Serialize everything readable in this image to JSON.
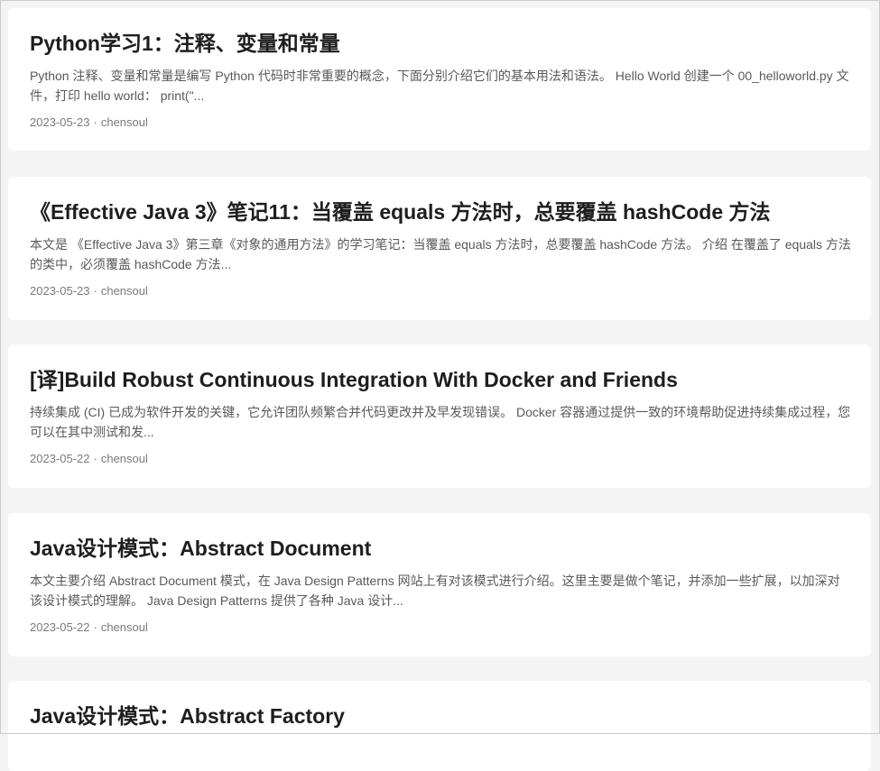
{
  "posts": [
    {
      "title": "Python学习1：注释、变量和常量",
      "summary": "Python 注释、变量和常量是编写 Python 代码时非常重要的概念，下面分别介绍它们的基本用法和语法。 Hello World 创建一个 00_helloworld.py 文件，打印 hello world： print(\"...",
      "date": "2023-05-23",
      "separator": "·",
      "author": "chensoul"
    },
    {
      "title": "《Effective Java 3》笔记11：当覆盖 equals 方法时，总要覆盖 hashCode 方法",
      "summary": "本文是 《Effective Java 3》第三章《对象的通用方法》的学习笔记：当覆盖 equals 方法时，总要覆盖 hashCode 方法。 介绍 在覆盖了 equals 方法的类中，必须覆盖 hashCode 方法...",
      "date": "2023-05-23",
      "separator": "·",
      "author": "chensoul"
    },
    {
      "title": "[译]Build Robust Continuous Integration With Docker and Friends",
      "summary": "持续集成 (CI) 已成为软件开发的关键，它允许团队频繁合并代码更改并及早发现错误。 Docker 容器通过提供一致的环境帮助促进持续集成过程，您可以在其中测试和发...",
      "date": "2023-05-22",
      "separator": "·",
      "author": "chensoul"
    },
    {
      "title": "Java设计模式：Abstract Document",
      "summary": "本文主要介绍 Abstract Document 模式，在 Java Design Patterns 网站上有对该模式进行介绍。这里主要是做个笔记，并添加一些扩展，以加深对该设计模式的理解。 Java Design Patterns 提供了各种 Java 设计...",
      "date": "2023-05-22",
      "separator": "·",
      "author": "chensoul"
    },
    {
      "title": "Java设计模式：Abstract Factory",
      "summary": "",
      "date": "",
      "separator": "",
      "author": ""
    }
  ]
}
